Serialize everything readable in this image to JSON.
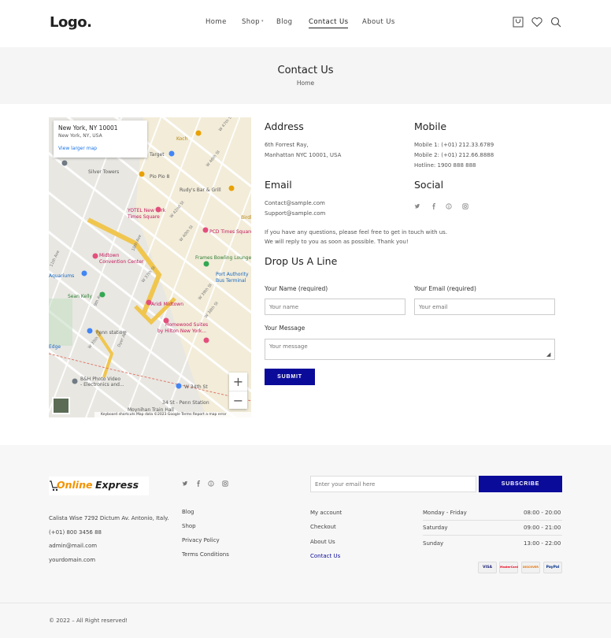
{
  "header": {
    "logo": "Logo.",
    "nav": [
      "Home",
      "Shop",
      "Blog",
      "Contact Us",
      "About Us"
    ],
    "icons": [
      "bag-icon",
      "heart-icon",
      "search-icon"
    ]
  },
  "banner": {
    "title": "Contact Us",
    "breadcrumb": "Home"
  },
  "map": {
    "place_title": "New York, NY 10001",
    "place_sub": "New York, NY, USA",
    "larger_map": "View larger map",
    "zoom_in": "+",
    "zoom_out": "−",
    "footer_text": "Keyboard shortcuts   Map data ©2023 Google   Terms   Report a map error",
    "labels": [
      "YOTEL New York Times Square",
      "Silver Towers",
      "Target",
      "Pio Pio 8",
      "Rudy's Bar & Grill",
      "Birdland Jazz",
      "PCD Times Square",
      "Midtown Convention Center",
      "Frames Bowling Lounge",
      "Port Authority Bus Terminal",
      "Sean Kelly",
      "Aridi Midtown",
      "Homewood Suites by Hilton New York",
      "Penn station",
      "B&H Photo Video - Electronics and...",
      "W 34th St",
      "34 St - Penn Station",
      "Moynihan Train Hall",
      "Koch",
      "W 47th St",
      "W 46th St",
      "W 42nd St",
      "W 40th St",
      "W 39th St",
      "W 38th St",
      "W 37th St",
      "W 35th St",
      "11th Ave",
      "10th Ave",
      "9th Ave",
      "Dyer Ave",
      "Aquariums",
      "Edge"
    ]
  },
  "address": {
    "title": "Address",
    "line1": "6th Forrest Ray,",
    "line2": "Manhattan NYC 10001, USA"
  },
  "mobile": {
    "title": "Mobile",
    "line1": "Mobile 1: (+01) 212.33.6789",
    "line2": "Mobile 2: (+01) 212.66.8888",
    "line3": "Hotline: 1900 888 888"
  },
  "email": {
    "title": "Email",
    "line1": "Contact@sample.com",
    "line2": "Support@sample.com"
  },
  "social": {
    "title": "Social",
    "icons": [
      "twitter-icon",
      "facebook-icon",
      "pinterest-icon",
      "instagram-icon"
    ]
  },
  "note": {
    "line1": "If you have any questions, please feel free to get in touch with us.",
    "line2": "We will reply to you as soon as possible. Thank you!"
  },
  "form": {
    "title": "Drop Us A Line",
    "name_label": "Your Name (required)",
    "name_placeholder": "Your name",
    "email_label": "Your Email (required)",
    "email_placeholder": "Your email",
    "message_label": "Your Message",
    "message_placeholder": "Your message",
    "submit": "SUBMIT"
  },
  "footer": {
    "brand_a": "Online",
    "brand_b": "Express",
    "address": "Calista Wise 7292 Dictum Av. Antonio, Italy.",
    "phone": "(+01) 800 3456 88",
    "email": "admin@mail.com",
    "domain": "yourdomain.com",
    "links1": [
      "Blog",
      "Shop",
      "Privacy Policy",
      "Terms Conditions"
    ],
    "links2": [
      "My account",
      "Checkout",
      "About Us",
      "Contact Us"
    ],
    "newsletter_placeholder": "Enter your email here",
    "subscribe": "SUBSCRIBE",
    "hours": [
      {
        "day": "Monday - Friday",
        "time": "08:00 - 20:00"
      },
      {
        "day": "Saturday",
        "time": "09:00 - 21:00"
      },
      {
        "day": "Sunday",
        "time": "13:00 - 22:00"
      }
    ],
    "cards": [
      "VISA",
      "MasterCard",
      "DISCOVER",
      "PayPal"
    ],
    "copyright": "© 2022 – All Right reserved!"
  },
  "colors": {
    "accent": "#0b0b9a",
    "brand_orange": "#f39200"
  }
}
